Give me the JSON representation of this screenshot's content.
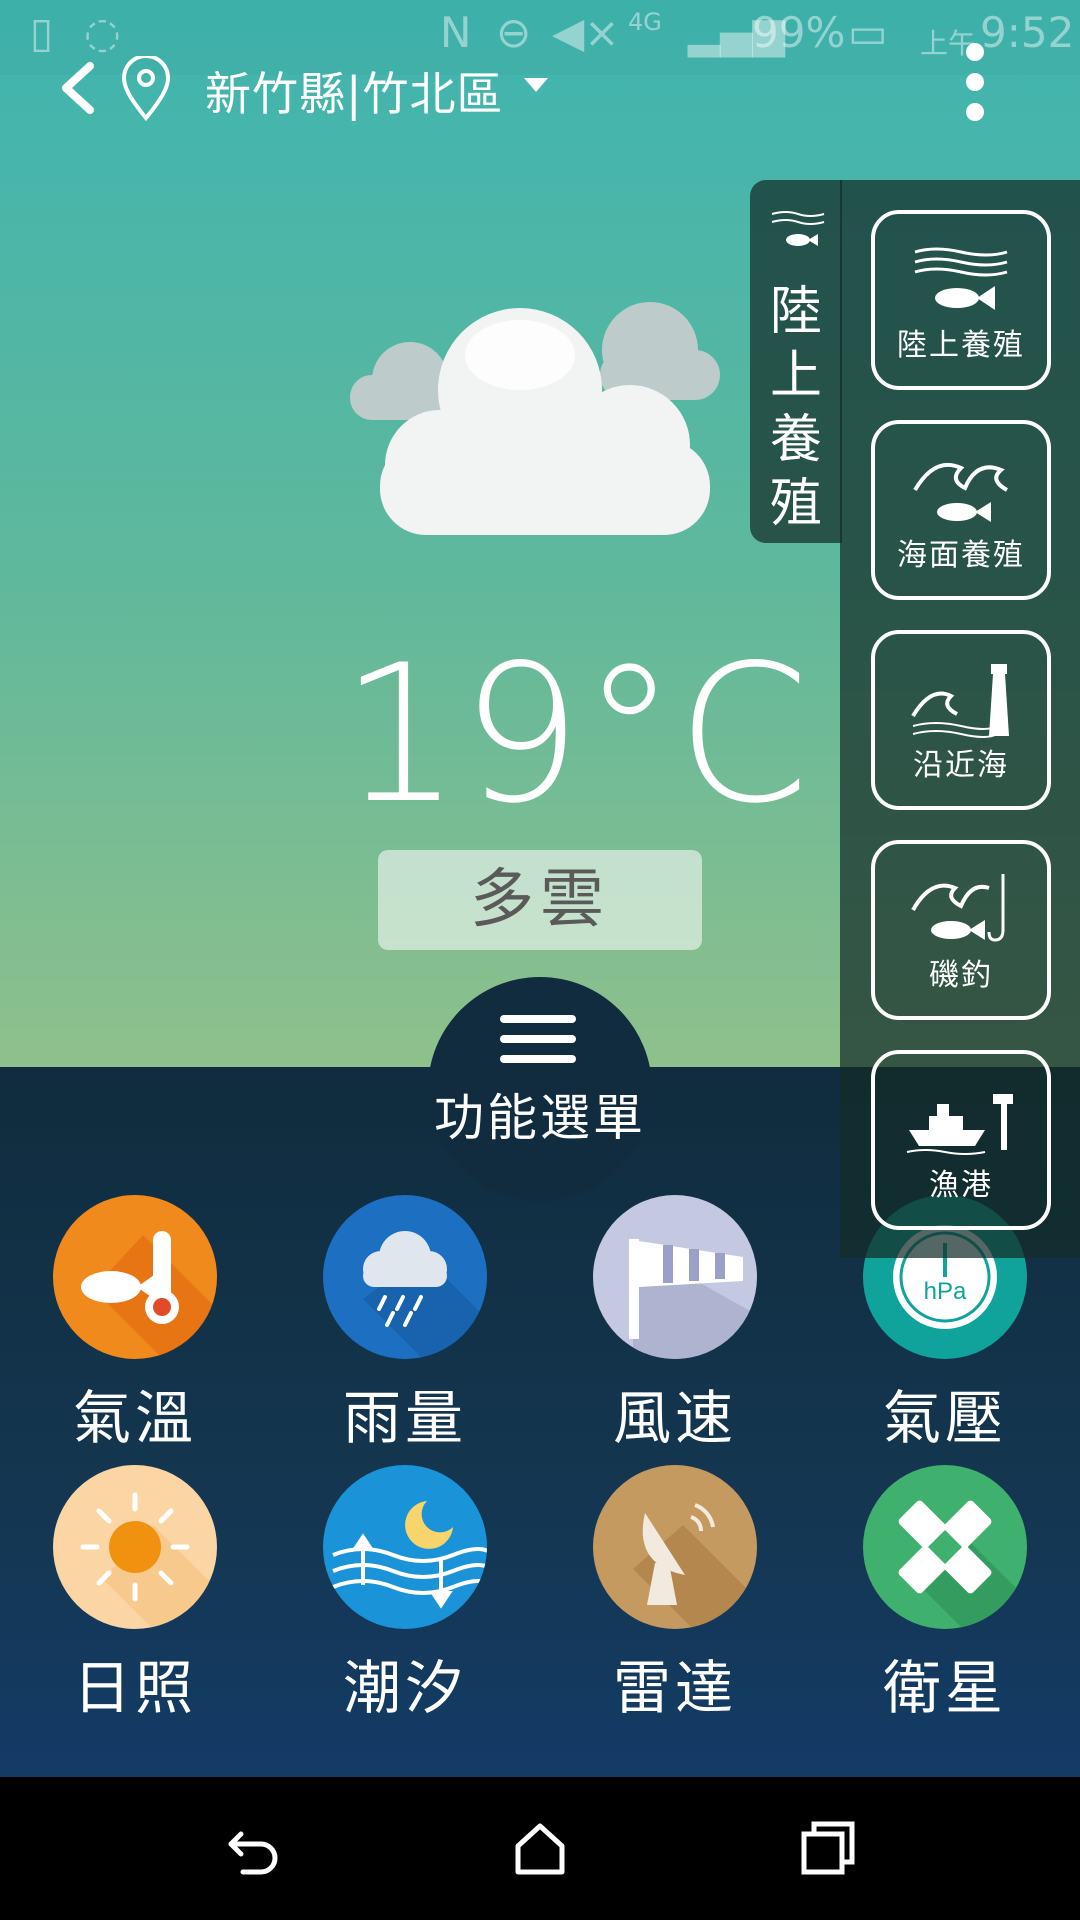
{
  "status": {
    "battery": "99%",
    "time_prefix": "上午",
    "time": "9:52",
    "network": "4G"
  },
  "header": {
    "location": "新竹縣|竹北區"
  },
  "weather": {
    "temperature": "19°C",
    "condition": "多雲"
  },
  "menu": {
    "label": "功能選單"
  },
  "functions": [
    {
      "label": "氣溫",
      "icon": "fish-thermometer-icon"
    },
    {
      "label": "雨量",
      "icon": "rain-cloud-icon"
    },
    {
      "label": "風速",
      "icon": "windsock-icon"
    },
    {
      "label": "氣壓",
      "icon": "barometer-icon",
      "unit": "hPa"
    },
    {
      "label": "日照",
      "icon": "sun-icon"
    },
    {
      "label": "潮汐",
      "icon": "tide-icon"
    },
    {
      "label": "雷達",
      "icon": "radar-dish-icon"
    },
    {
      "label": "衛星",
      "icon": "satellite-icon"
    }
  ],
  "drawer": {
    "tab_label": "陸上養殖",
    "items": [
      {
        "label": "陸上養殖",
        "icon": "land-aquaculture-icon"
      },
      {
        "label": "海面養殖",
        "icon": "sea-aquaculture-icon"
      },
      {
        "label": "沿近海",
        "icon": "coastal-lighthouse-icon"
      },
      {
        "label": "磯釣",
        "icon": "rock-fishing-icon"
      },
      {
        "label": "漁港",
        "icon": "fishing-port-icon"
      }
    ]
  },
  "colors": {
    "panel": "#102c3e",
    "temp_orange": "#f08a1c",
    "rain_blue": "#1d6fc2",
    "pressure_teal": "#10a39c",
    "satellite_green": "#3fb06e"
  }
}
